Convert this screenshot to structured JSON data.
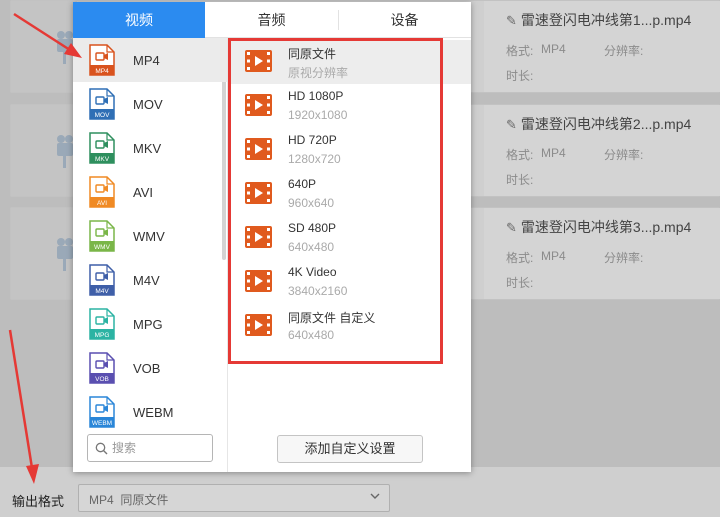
{
  "colors": {
    "accent": "#2b8bf0",
    "highlight_outline": "#e53935",
    "video_icon": "#e05a1e"
  },
  "popup": {
    "tabs": [
      {
        "label": "视频",
        "active": true
      },
      {
        "label": "音频",
        "active": false
      },
      {
        "label": "设备",
        "active": false
      }
    ],
    "formats": [
      {
        "label": "MP4",
        "badge": "MP4",
        "color": "#d9531e",
        "selected": true
      },
      {
        "label": "MOV",
        "badge": "MOV",
        "color": "#2f6fb5",
        "selected": false
      },
      {
        "label": "MKV",
        "badge": "MKV",
        "color": "#2e8f5e",
        "selected": false
      },
      {
        "label": "AVI",
        "badge": "AVI",
        "color": "#f08a24",
        "selected": false
      },
      {
        "label": "WMV",
        "badge": "WMV",
        "color": "#7ab648",
        "selected": false
      },
      {
        "label": "M4V",
        "badge": "M4V",
        "color": "#3f5fa8",
        "selected": false
      },
      {
        "label": "MPG",
        "badge": "MPG",
        "color": "#2bb3a3",
        "selected": false
      },
      {
        "label": "VOB",
        "badge": "VOB",
        "color": "#5a4fb0",
        "selected": false
      },
      {
        "label": "WEBM",
        "badge": "WEBM",
        "color": "#2a86d8",
        "selected": false
      }
    ],
    "search": {
      "placeholder": "搜索",
      "value": ""
    },
    "resolutions": [
      {
        "name": "同原文件",
        "sub": "原视分辨率",
        "selected": true
      },
      {
        "name": "HD 1080P",
        "sub": "1920x1080",
        "selected": false
      },
      {
        "name": "HD 720P",
        "sub": "1280x720",
        "selected": false
      },
      {
        "name": "640P",
        "sub": "960x640",
        "selected": false
      },
      {
        "name": "SD 480P",
        "sub": "640x480",
        "selected": false
      },
      {
        "name": "4K Video",
        "sub": "3840x2160",
        "selected": false
      },
      {
        "name": "同原文件 自定义",
        "sub": "640x480",
        "selected": false
      }
    ],
    "add_custom_label": "添加自定义设置"
  },
  "files": [
    {
      "name": "雷速登闪电冲线第1...p.mp4",
      "format_label": "格式:",
      "format_value": "MP4",
      "resolution_label": "分辨率:",
      "duration_label": "时长:"
    },
    {
      "name": "雷速登闪电冲线第2...p.mp4",
      "format_label": "格式:",
      "format_value": "MP4",
      "resolution_label": "分辨率:",
      "duration_label": "时长:"
    },
    {
      "name": "雷速登闪电冲线第3...p.mp4",
      "format_label": "格式:",
      "format_value": "MP4",
      "resolution_label": "分辨率:",
      "duration_label": "时长:"
    }
  ],
  "output": {
    "label": "输出格式",
    "selected": "MP4  同原文件"
  }
}
